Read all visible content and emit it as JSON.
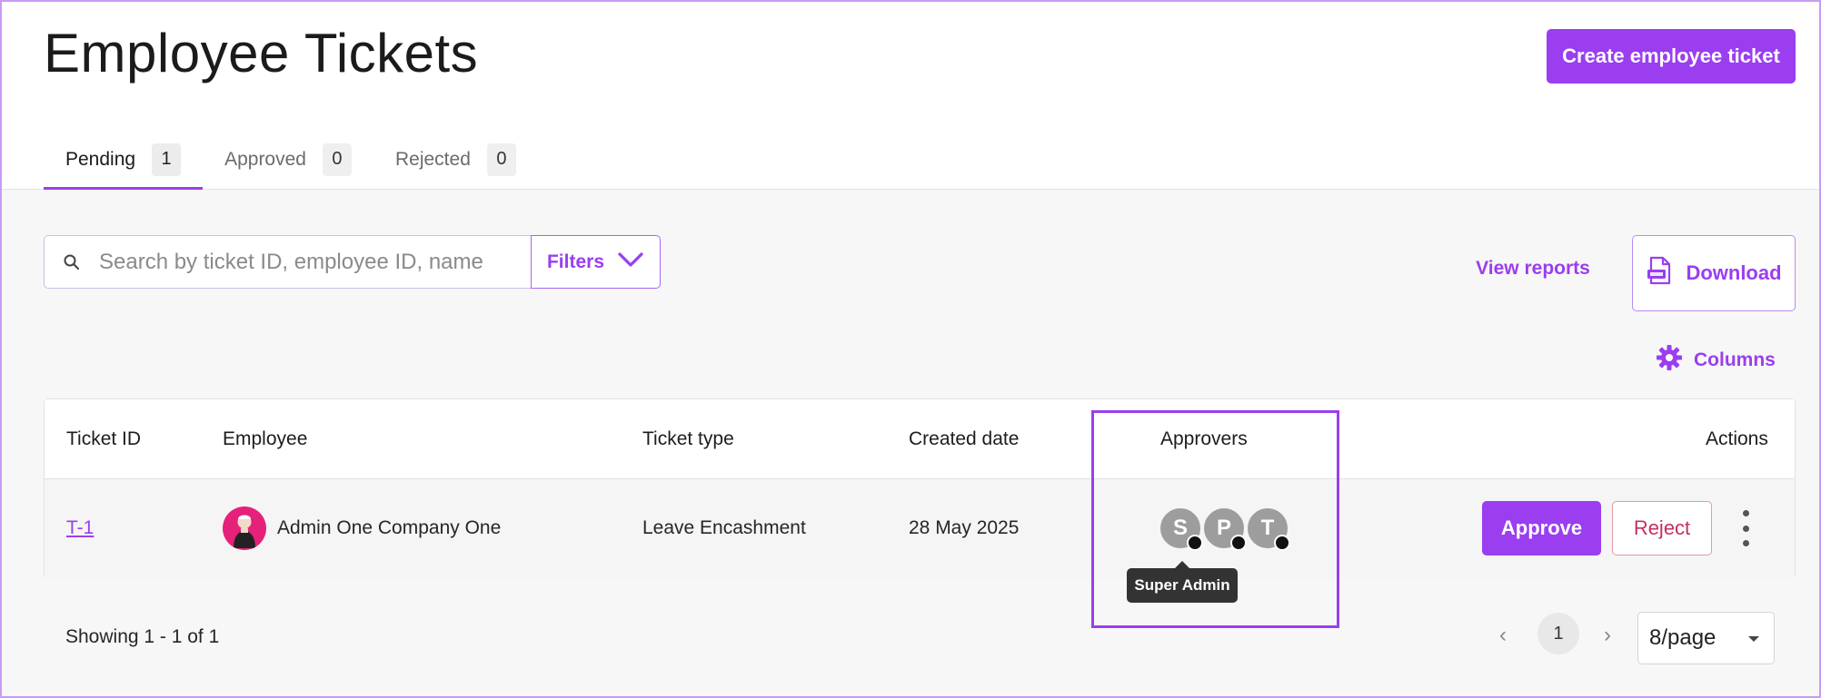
{
  "header": {
    "title": "Employee Tickets",
    "create_button": "Create employee ticket"
  },
  "tabs": [
    {
      "label": "Pending",
      "count": "1",
      "active": true
    },
    {
      "label": "Approved",
      "count": "0",
      "active": false
    },
    {
      "label": "Rejected",
      "count": "0",
      "active": false
    }
  ],
  "toolbar": {
    "search_placeholder": "Search by ticket ID, employee ID, name",
    "filters_label": "Filters",
    "view_reports_label": "View reports",
    "download_label": "Download",
    "columns_label": "Columns"
  },
  "table": {
    "columns": [
      "Ticket ID",
      "Employee",
      "Ticket type",
      "Created date",
      "Approvers",
      "Actions"
    ],
    "rows": [
      {
        "ticket_id": "T-1",
        "employee": "Admin One Company One",
        "ticket_type": "Leave Encashment",
        "created_date": "28 May 2025",
        "approvers": [
          "S",
          "P",
          "T"
        ],
        "approve_label": "Approve",
        "reject_label": "Reject"
      }
    ]
  },
  "tooltip": {
    "text": "Super Admin"
  },
  "footer": {
    "showing": "Showing 1 - 1 of 1",
    "current_page": "1",
    "prev_icon": "‹",
    "next_icon": "›",
    "page_size": "8/page"
  },
  "colors": {
    "accent": "#9a3ef0",
    "reject": "#c62f61",
    "avatar": "#e6217a",
    "approver_avatar": "#9d9d9d"
  }
}
